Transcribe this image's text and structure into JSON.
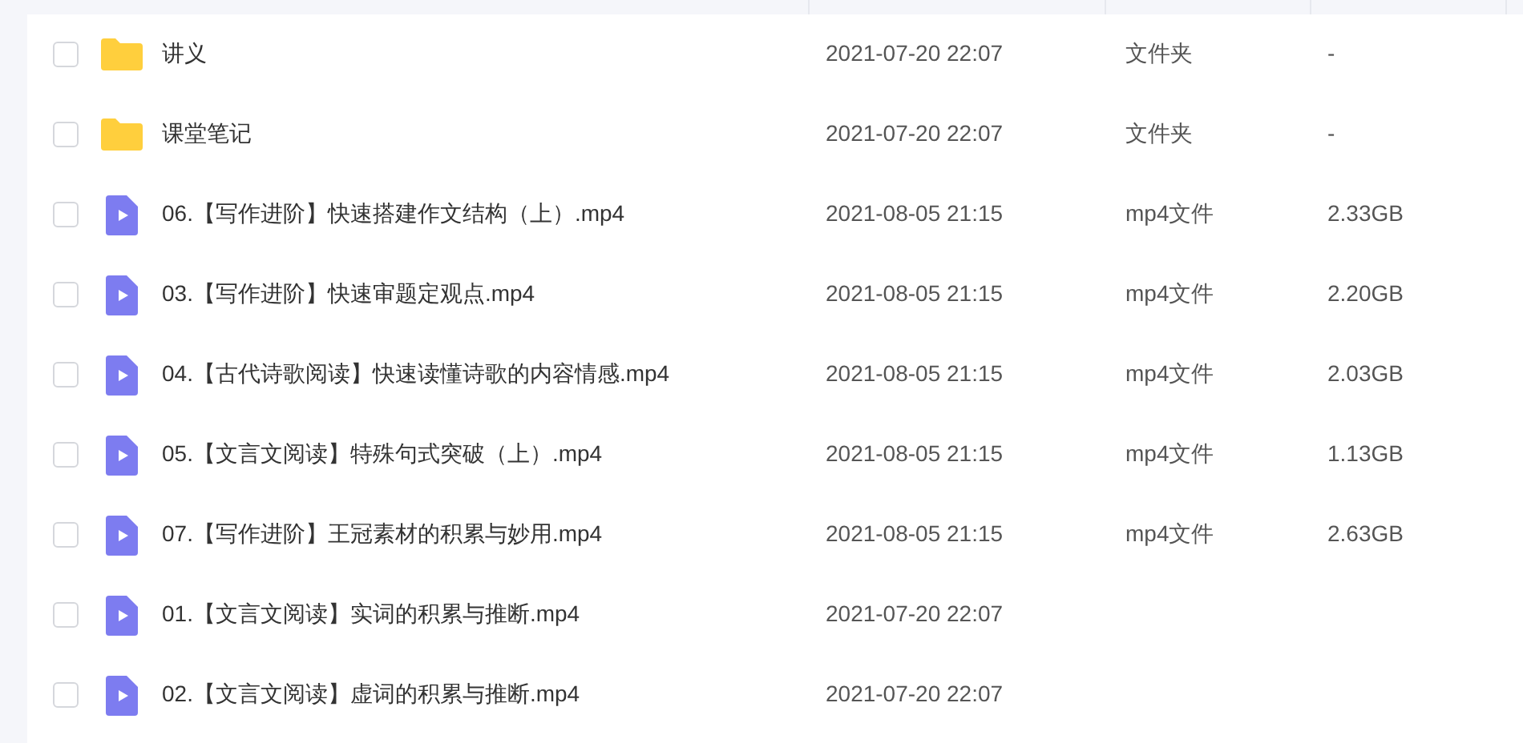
{
  "files": [
    {
      "kind": "folder",
      "name": "讲义",
      "checked": false,
      "modified": "2021-07-20 22:07",
      "type": "文件夹",
      "size": "-"
    },
    {
      "kind": "folder",
      "name": "课堂笔记",
      "checked": false,
      "modified": "2021-07-20 22:07",
      "type": "文件夹",
      "size": "-"
    },
    {
      "kind": "video",
      "name": "06.【写作进阶】快速搭建作文结构（上）.mp4",
      "checked": false,
      "modified": "2021-08-05 21:15",
      "type": "mp4文件",
      "size": "2.33GB"
    },
    {
      "kind": "video",
      "name": "03.【写作进阶】快速审题定观点.mp4",
      "checked": false,
      "modified": "2021-08-05 21:15",
      "type": "mp4文件",
      "size": "2.20GB"
    },
    {
      "kind": "video",
      "name": "04.【古代诗歌阅读】快速读懂诗歌的内容情感.mp4",
      "checked": false,
      "modified": "2021-08-05 21:15",
      "type": "mp4文件",
      "size": "2.03GB"
    },
    {
      "kind": "video",
      "name": "05.【文言文阅读】特殊句式突破（上）.mp4",
      "checked": false,
      "modified": "2021-08-05 21:15",
      "type": "mp4文件",
      "size": "1.13GB"
    },
    {
      "kind": "video",
      "name": "07.【写作进阶】王冠素材的积累与妙用.mp4",
      "checked": false,
      "modified": "2021-08-05 21:15",
      "type": "mp4文件",
      "size": "2.63GB"
    },
    {
      "kind": "video",
      "name": "01.【文言文阅读】实词的积累与推断.mp4",
      "checked": false,
      "modified": "2021-07-20 22:07"
    },
    {
      "kind": "video",
      "name": "02.【文言文阅读】虚词的积累与推断.mp4",
      "checked": false,
      "modified": "2021-07-20 22:07"
    }
  ]
}
